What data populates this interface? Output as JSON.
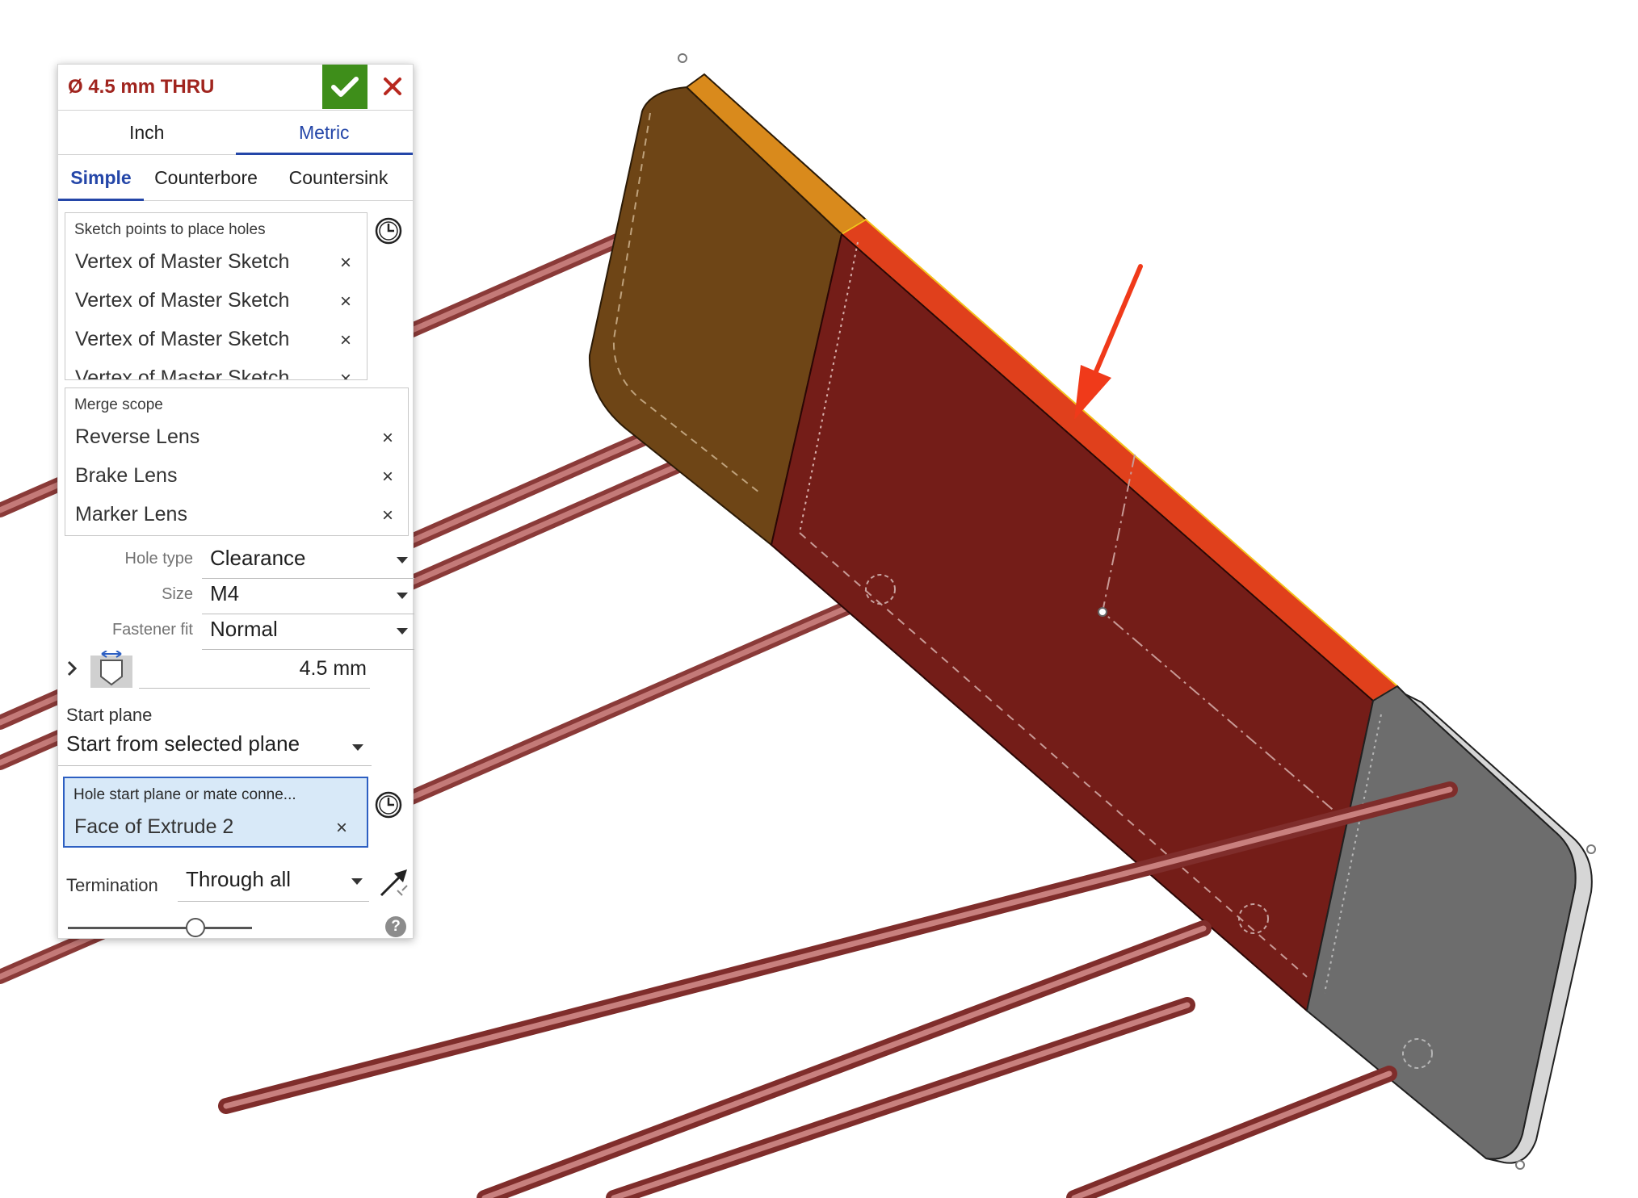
{
  "dialog": {
    "title": "Ø 4.5 mm THRU",
    "confirm_icon": "checkmark-icon",
    "cancel_icon": "close-icon",
    "unit_tabs": [
      {
        "label": "Inch",
        "active": false
      },
      {
        "label": "Metric",
        "active": true
      }
    ],
    "hole_style_tabs": [
      {
        "label": "Simple",
        "active": true
      },
      {
        "label": "Counterbore",
        "active": false
      },
      {
        "label": "Countersink",
        "active": false
      }
    ],
    "sketch_points": {
      "label": "Sketch points to place holes",
      "items": [
        "Vertex of Master Sketch",
        "Vertex of Master Sketch",
        "Vertex of Master Sketch",
        "Vertex of Master Sketch"
      ]
    },
    "merge_scope": {
      "label": "Merge scope",
      "items": [
        "Reverse Lens",
        "Brake Lens",
        "Marker Lens"
      ]
    },
    "hole_type": {
      "label": "Hole type",
      "value": "Clearance"
    },
    "size": {
      "label": "Size",
      "value": "M4"
    },
    "fastener_fit": {
      "label": "Fastener fit",
      "value": "Normal"
    },
    "diameter": {
      "value": "4.5 mm",
      "icon": "hole-diameter-icon"
    },
    "start_plane": {
      "label": "Start plane",
      "value": "Start from selected plane"
    },
    "hole_start": {
      "label": "Hole start plane or mate conne...",
      "value": "Face of Extrude 2"
    },
    "termination": {
      "label": "Termination",
      "value": "Through all",
      "flip_icon": "direction-arrow-icon"
    },
    "help_icon": "help-icon",
    "clock_icon": "history-clock-icon",
    "remove_glyph": "×"
  },
  "colors": {
    "title": "#a0241e",
    "confirm": "#3e8e1a",
    "active_tab": "#2446a8",
    "selected_face": "#e0401c",
    "body_brown": "#6e4516",
    "body_red": "#741d18",
    "body_gray": "#6d6d6d",
    "annotation_arrow": "#f03a1a",
    "rods": "#b35a58"
  }
}
